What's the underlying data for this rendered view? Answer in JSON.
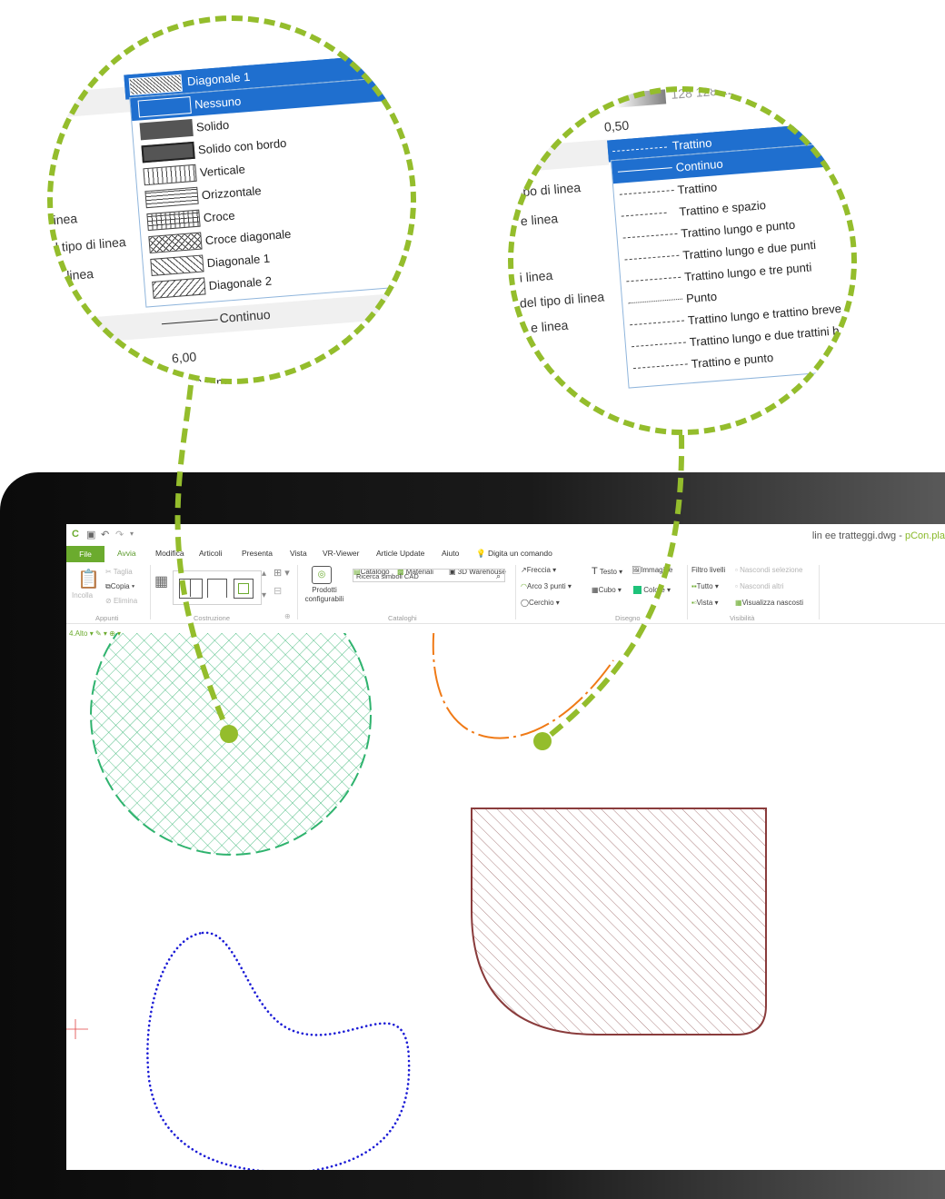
{
  "window": {
    "title": "lin ee tratteggi.dwg",
    "app": "pCon.pla"
  },
  "quick_access": [
    "save-icon",
    "undo-icon",
    "redo-icon"
  ],
  "tabs": [
    "File",
    "Avvia",
    "Modifica",
    "Articoli",
    "Presenta",
    "Vista",
    "VR-Viewer",
    "Article Update",
    "Aiuto",
    "Digita un comando"
  ],
  "ribbon": {
    "appunti": {
      "label": "Appunti",
      "paste": "Incolla",
      "cut": "Taglia",
      "copy": "Copia",
      "delete": "Elimina"
    },
    "costruzione": {
      "label": "Costruzione"
    },
    "cataloghi": {
      "label": "Cataloghi",
      "products": "Prodotti configurabili",
      "catalog": "Catalogo",
      "materials": "Materiali",
      "warehouse": "3D Warehouse",
      "search_placeholder": "Ricerca simboli CAD"
    },
    "disegno": {
      "label": "Disegno",
      "arrow": "Freccia",
      "arc": "Arco 3 punti",
      "circle": "Cerchio",
      "text": "Testo",
      "image": "Immagine",
      "cube": "Cubo",
      "color": "Colore"
    },
    "visibilita": {
      "label": "Visibilità",
      "filter": "Filtro livelli",
      "hide_sel": "Nascondi selezione",
      "all": "Tutto",
      "hide_others": "Nascondi altri",
      "view": "Vista",
      "show_hidden": "Visualizza nascosti"
    }
  },
  "layer": "4.Alto",
  "accent": "#6bab2e",
  "lens_color": "#94bd2c",
  "hatch_panel": {
    "labels": [
      "o",
      "inea",
      "l tipo di linea",
      "linea",
      "nea"
    ],
    "current": "Diagonale 1",
    "options": [
      "Nessuno",
      "Solido",
      "Solido con bordo",
      "Verticale",
      "Orizzontale",
      "Croce",
      "Croce diagonale",
      "Diagonale 1",
      "Diagonale 2"
    ],
    "linetype": "Continuo",
    "value1": "6,00",
    "value2": "1.20 mm"
  },
  "linetype_panel": {
    "color_value": "128 128 12",
    "width": "0,50",
    "labels": [
      "tipo di linea",
      "e linea",
      "i linea",
      "del tipo di linea",
      "e linea"
    ],
    "current": "Trattino",
    "options": [
      "Continuo",
      "Trattino",
      "Trattino e spazio",
      "Trattino lungo e punto",
      "Trattino lungo e due punti",
      "Trattino lungo e tre punti",
      "Punto",
      "Trattino lungo e trattino breve",
      "Trattino lungo e due trattini b",
      "Trattino e punto"
    ]
  }
}
